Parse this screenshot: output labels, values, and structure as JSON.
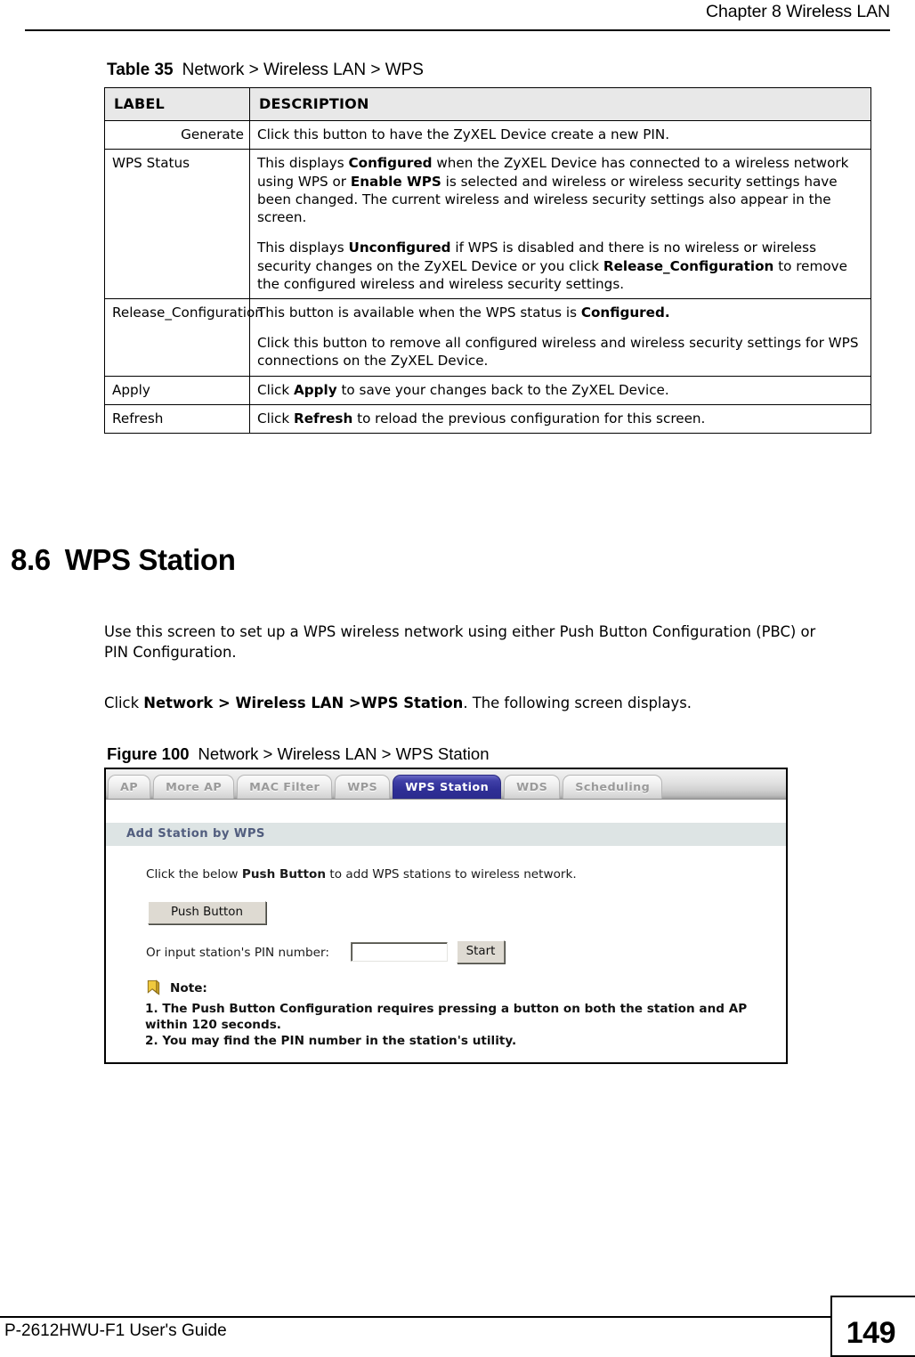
{
  "page_header": {
    "chapter": "Chapter 8 Wireless LAN"
  },
  "table": {
    "caption_label": "Table 35",
    "caption_text": "Network > Wireless LAN > WPS",
    "columns": [
      "LABEL",
      "DESCRIPTION"
    ],
    "rows": [
      {
        "label": "Generate",
        "label_align": "right",
        "paragraphs": [
          [
            {
              "t": "Click this button to have the ZyXEL Device create a new PIN.",
              "b": false
            }
          ]
        ]
      },
      {
        "label": "WPS Status",
        "label_align": "left",
        "paragraphs": [
          [
            {
              "t": "This displays ",
              "b": false
            },
            {
              "t": "Configured",
              "b": true
            },
            {
              "t": " when the ZyXEL Device has connected to a wireless network using WPS or ",
              "b": false
            },
            {
              "t": "Enable WPS",
              "b": true
            },
            {
              "t": " is selected and wireless or wireless security settings have been changed. The current wireless and wireless security settings also appear in the screen.",
              "b": false
            }
          ],
          [
            {
              "t": "This displays ",
              "b": false
            },
            {
              "t": "Unconfigured",
              "b": true
            },
            {
              "t": " if WPS is disabled and there is no wireless or wireless security changes on the ZyXEL Device or you click ",
              "b": false
            },
            {
              "t": "Release_Configuration",
              "b": true
            },
            {
              "t": " to remove the configured wireless and wireless security settings.",
              "b": false
            }
          ]
        ]
      },
      {
        "label": "Release_Configuration",
        "label_align": "right",
        "paragraphs": [
          [
            {
              "t": "This button is available when the WPS status is ",
              "b": false
            },
            {
              "t": "Configured.",
              "b": true
            }
          ],
          [
            {
              "t": "Click this button to remove all configured wireless and wireless security settings  for WPS connections on the ZyXEL Device.",
              "b": false
            }
          ]
        ]
      },
      {
        "label": "Apply",
        "label_align": "left",
        "paragraphs": [
          [
            {
              "t": "Click ",
              "b": false
            },
            {
              "t": "Apply",
              "b": true
            },
            {
              "t": " to save your changes back to the ZyXEL Device.",
              "b": false
            }
          ]
        ]
      },
      {
        "label": "Refresh",
        "label_align": "left",
        "paragraphs": [
          [
            {
              "t": "Click ",
              "b": false
            },
            {
              "t": "Refresh",
              "b": true
            },
            {
              "t": " to reload the previous configuration for this screen.",
              "b": false
            }
          ]
        ]
      }
    ]
  },
  "section": {
    "number": "8.6",
    "title": "WPS Station",
    "paragraphs": [
      {
        "id": "para-intro",
        "runs": [
          {
            "t": "Use this screen to set up a WPS wireless network using either Push Button Configuration (PBC) or PIN Configuration.",
            "b": false
          }
        ]
      },
      {
        "id": "para-click",
        "runs": [
          {
            "t": "Click ",
            "b": false
          },
          {
            "t": "Network > Wireless LAN >WPS Station",
            "b": true
          },
          {
            "t": ". The following screen displays.",
            "b": false
          }
        ]
      }
    ]
  },
  "figure": {
    "caption_label": "Figure 100",
    "caption_text": "Network > Wireless LAN > WPS Station",
    "tabs": [
      {
        "label": "AP",
        "active": false
      },
      {
        "label": "More AP",
        "active": false
      },
      {
        "label": "MAC Filter",
        "active": false
      },
      {
        "label": "WPS",
        "active": false
      },
      {
        "label": "WPS Station",
        "active": true
      },
      {
        "label": "WDS",
        "active": false
      },
      {
        "label": "Scheduling",
        "active": false
      }
    ],
    "section_bar": "Add Station by WPS",
    "instruction": [
      {
        "t": "Click the below ",
        "b": false
      },
      {
        "t": "Push Button",
        "b": true
      },
      {
        "t": " to add WPS stations to wireless network.",
        "b": false
      }
    ],
    "push_button_label": "Push Button",
    "pin_label": "Or input station's PIN number:",
    "pin_value": "",
    "pin_placeholder": "",
    "start_button_label": "Start",
    "note_title": "Note:",
    "note_items": [
      "1. The Push Button Configuration requires pressing a button on both the station and AP within 120 seconds.",
      "2. You may find the PIN number in the station's utility."
    ],
    "colors": {
      "active_tab": "#2f2f96",
      "section_bar_bg": "#dde4e4",
      "section_bar_text": "#515d7e",
      "note_icon": "#e8c23a"
    }
  },
  "footer": {
    "guide": "P-2612HWU-F1 User's Guide",
    "page_number": "149"
  }
}
